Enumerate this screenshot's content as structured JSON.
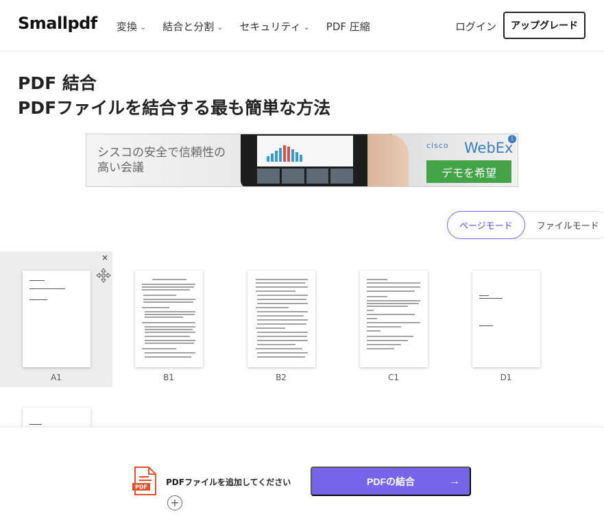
{
  "header": {
    "logo": "Smallpdf",
    "nav": [
      {
        "label": "変換",
        "chevron": "⌄"
      },
      {
        "label": "結合と分割",
        "chevron": "⌄"
      },
      {
        "label": "セキュリティ",
        "chevron": "⌄"
      },
      {
        "label": "PDF 圧縮",
        "chevron": ""
      }
    ],
    "login": "ログイン",
    "upgrade": "アップグレード"
  },
  "page": {
    "title": "PDF 結合",
    "subtitle": "PDFファイルを結合する最も簡単な方法"
  },
  "ad": {
    "text": "シスコの安全で信頼性の高い会議",
    "brand_small": "cisco",
    "brand": "WebEx",
    "cta": "デモを希望",
    "info": "i"
  },
  "mode": {
    "page_mode": "ページモード",
    "file_mode": "ファイルモード"
  },
  "pages": [
    {
      "label": "A1",
      "selected": true
    },
    {
      "label": "B1",
      "selected": false
    },
    {
      "label": "B2",
      "selected": false
    },
    {
      "label": "C1",
      "selected": false
    },
    {
      "label": "D1",
      "selected": false
    },
    {
      "label": "",
      "selected": false
    }
  ],
  "tile_controls": {
    "close": "×"
  },
  "bottom": {
    "add_text": "PDFファイルを追加してください",
    "add_plus": "+",
    "merge_label": "PDFの結合",
    "merge_arrow": "→",
    "pdf_icon_label": "PDF"
  },
  "colors": {
    "accent": "#7864e8",
    "cta_green": "#43a447",
    "selected_tile": "#ededed"
  }
}
